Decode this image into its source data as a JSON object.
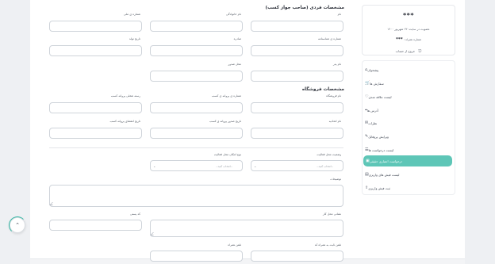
{
  "profile": {
    "masked_name": "***",
    "member_since": "عضویت در سایت: ۲۳ شهریور ۱۴۰۰",
    "phone_label": "شماره همراه :",
    "phone_value": "***",
    "logout_label": "خروج از حساب",
    "logout_icon": "logout-icon"
  },
  "menu": {
    "items": [
      {
        "label": "پیشخوان",
        "icon": "dashboard-icon",
        "glyph": "⌂"
      },
      {
        "label": "سفارش ها",
        "icon": "cart-icon",
        "glyph": "🛒"
      },
      {
        "label": "لیست علاقه مندی",
        "icon": "heart-icon",
        "glyph": "♡"
      },
      {
        "label": "آدرس ها",
        "icon": "map-icon",
        "glyph": "⌖"
      },
      {
        "label": "نظرات",
        "icon": "comment-icon",
        "glyph": "✉"
      },
      {
        "label": "ویرایش پروفایل",
        "icon": "edit-icon",
        "glyph": "✎"
      },
      {
        "label": "لیست درخواست ها",
        "icon": "list-icon",
        "glyph": "☰"
      },
      {
        "label": "درخواست اعتباری حقیقی",
        "icon": "credit-icon",
        "glyph": "▣",
        "active": true
      },
      {
        "label": "لیست فیش های واریزی",
        "icon": "receipt-icon",
        "glyph": "▤"
      },
      {
        "label": "ثبت فیش واریزی",
        "icon": "upload-icon",
        "glyph": "⇪"
      }
    ]
  },
  "form": {
    "personal_title": "مشخصات فردی (صاحب جواز کسب)",
    "store_title": "مشخصات فروشگاه",
    "personal": {
      "first_name": "نام",
      "last_name": "نام خانوادگی",
      "national_code": "شماره ی ملی",
      "id_number": "شماره ی شناسنامه",
      "issue_place": "محل صدور",
      "birth_date": "تاریخ تولد",
      "father_name": "نام پدر",
      "issue_date": "صادره",
      "education": "مدرک تحصیلی"
    },
    "store": {
      "store_name": "نام فروشگاه",
      "license_number": "شماره ی پروانه ی کسب",
      "license_validity": "رسته شغلی پروانه کسب",
      "union_name": "نام اتحادیه",
      "license_issue_date": "تاریخ صدور پروانه ی کسب",
      "license_expiry_date": "تاریخ انقضای پروانه کسب",
      "activity_status": "وضعیت محل فعالیت",
      "activity_type": "نوع امکان محل فعالیت",
      "select_placeholder": "--انتخاب کنید--",
      "description": "توضیحات",
      "address": "نشانی محل کار",
      "postal_code": "کد پستی",
      "phone": "تلفن ثابت به همراه کد",
      "mobile": "تلفن همراه"
    }
  },
  "accent_color": "#5ec6b7",
  "scroll_top_icon": "chevron-up-icon"
}
